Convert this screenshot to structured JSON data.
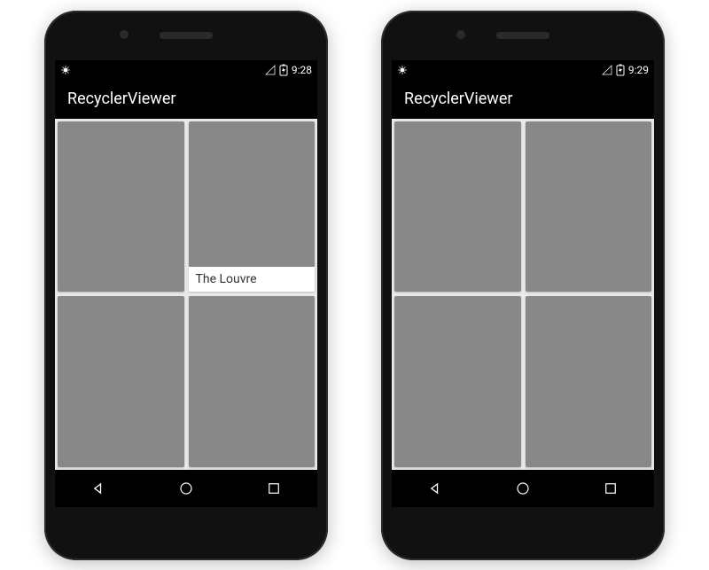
{
  "phones": [
    {
      "status": {
        "time": "9:28"
      },
      "app_title": "RecyclerViewer",
      "cards": [
        {
          "name": "card-guards",
          "img_class": "guards",
          "caption": null
        },
        {
          "name": "card-louvre",
          "img_class": "louvre",
          "caption": "The Louvre"
        },
        {
          "name": "card-eiffel",
          "img_class": "eiffel",
          "caption": null
        },
        {
          "name": "card-phones",
          "img_class": "phones",
          "caption": null
        }
      ]
    },
    {
      "status": {
        "time": "9:29"
      },
      "app_title": "RecyclerViewer",
      "cards": [
        {
          "name": "card-flags",
          "img_class": "flags",
          "caption": null
        },
        {
          "name": "card-building",
          "img_class": "building",
          "caption": null
        },
        {
          "name": "card-bridge",
          "img_class": "bridge",
          "caption": null
        },
        {
          "name": "card-castle",
          "img_class": "castle",
          "caption": null
        }
      ]
    }
  ],
  "nav": {
    "back": "Back",
    "home": "Home",
    "recents": "Recents"
  }
}
